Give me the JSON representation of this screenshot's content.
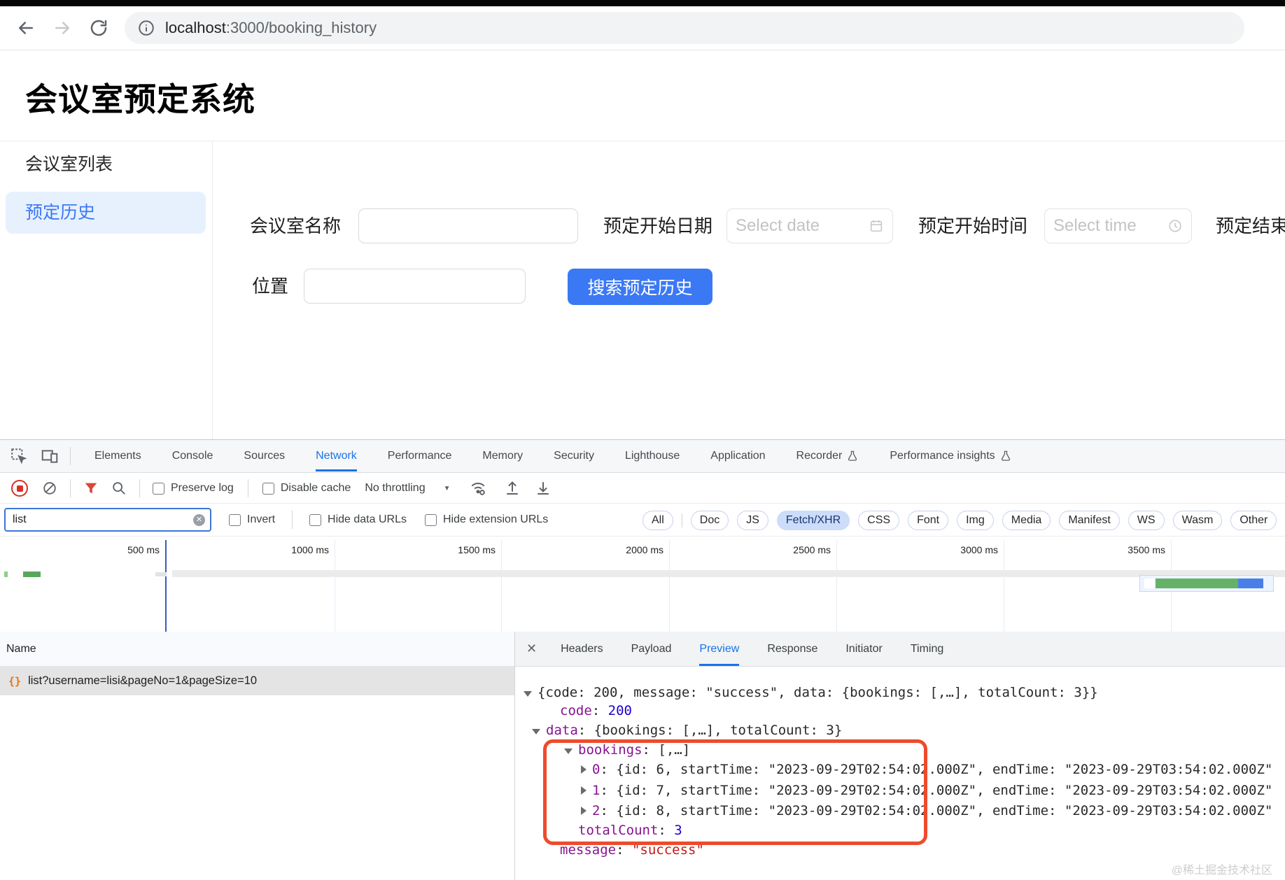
{
  "window": {
    "url_host": "localhost",
    "url_path": ":3000/booking_history"
  },
  "page": {
    "title": "会议室预定系统",
    "sidebar": {
      "items": [
        {
          "label": "会议室列表",
          "selected": false
        },
        {
          "label": "预定历史",
          "selected": true
        }
      ]
    },
    "form": {
      "room_name_label": "会议室名称",
      "start_date_label": "预定开始日期",
      "start_date_placeholder": "Select date",
      "start_time_label": "预定开始时间",
      "start_time_placeholder": "Select time",
      "end_label": "预定结束",
      "location_label": "位置",
      "search_button": "搜索预定历史"
    }
  },
  "devtools": {
    "tabs": [
      "Elements",
      "Console",
      "Sources",
      "Network",
      "Performance",
      "Memory",
      "Security",
      "Lighthouse",
      "Application",
      "Recorder",
      "Performance insights"
    ],
    "active_tab": "Network",
    "toolbar": {
      "preserve_log": "Preserve log",
      "disable_cache": "Disable cache",
      "throttling": "No throttling"
    },
    "filter": {
      "value": "list",
      "invert": "Invert",
      "hide_data_urls": "Hide data URLs",
      "hide_extension_urls": "Hide extension URLs",
      "chips": [
        "All",
        "Doc",
        "JS",
        "Fetch/XHR",
        "CSS",
        "Font",
        "Img",
        "Media",
        "Manifest",
        "WS",
        "Wasm",
        "Other"
      ],
      "active_chip": "Fetch/XHR"
    },
    "timeline": {
      "ticks": [
        "500 ms",
        "1000 ms",
        "1500 ms",
        "2000 ms",
        "2500 ms",
        "3000 ms",
        "3500 ms"
      ]
    },
    "requests": {
      "column": "Name",
      "selected": "list?username=lisi&pageNo=1&pageSize=10"
    },
    "detail_tabs": [
      "Headers",
      "Payload",
      "Preview",
      "Response",
      "Initiator",
      "Timing"
    ],
    "active_detail_tab": "Preview",
    "preview": {
      "sep": ": ",
      "root": "{code: 200, message: \"success\", data: {bookings: [,…], totalCount: 3}}",
      "code_key": "code",
      "code_val": "200",
      "data_key": "data",
      "data_rest": ": {bookings: [,…], totalCount: 3}",
      "bookings_key": "bookings",
      "bookings_rest": ": [,…]",
      "row0_key": "0",
      "row0_rest": ": {id: 6, startTime: \"2023-09-29T02:54:02.000Z\", endTime: \"2023-09-29T03:54:02.000Z\"",
      "row1_key": "1",
      "row1_rest": ": {id: 7, startTime: \"2023-09-29T02:54:02.000Z\", endTime: \"2023-09-29T03:54:02.000Z\"",
      "row2_key": "2",
      "row2_rest": ": {id: 8, startTime: \"2023-09-29T02:54:02.000Z\", endTime: \"2023-09-29T03:54:02.000Z\"",
      "total_key": "totalCount",
      "total_val": "3",
      "message_key": "message",
      "message_val": "\"success\""
    },
    "watermark": "@稀土掘金技术社区"
  },
  "icons": {
    "close": "✕",
    "dropdown_arrow": "▼",
    "json_braces": "{}"
  },
  "colors": {
    "devtools_accent": "#1a73e8",
    "button_blue": "#3b78f4",
    "sidebar_selected_bg": "#e7f1fe",
    "annotation_red": "#ed4b2c",
    "json_key": "#881391",
    "json_number": "#1c00cf",
    "json_string": "#c41a16",
    "record_red": "#d93025"
  }
}
